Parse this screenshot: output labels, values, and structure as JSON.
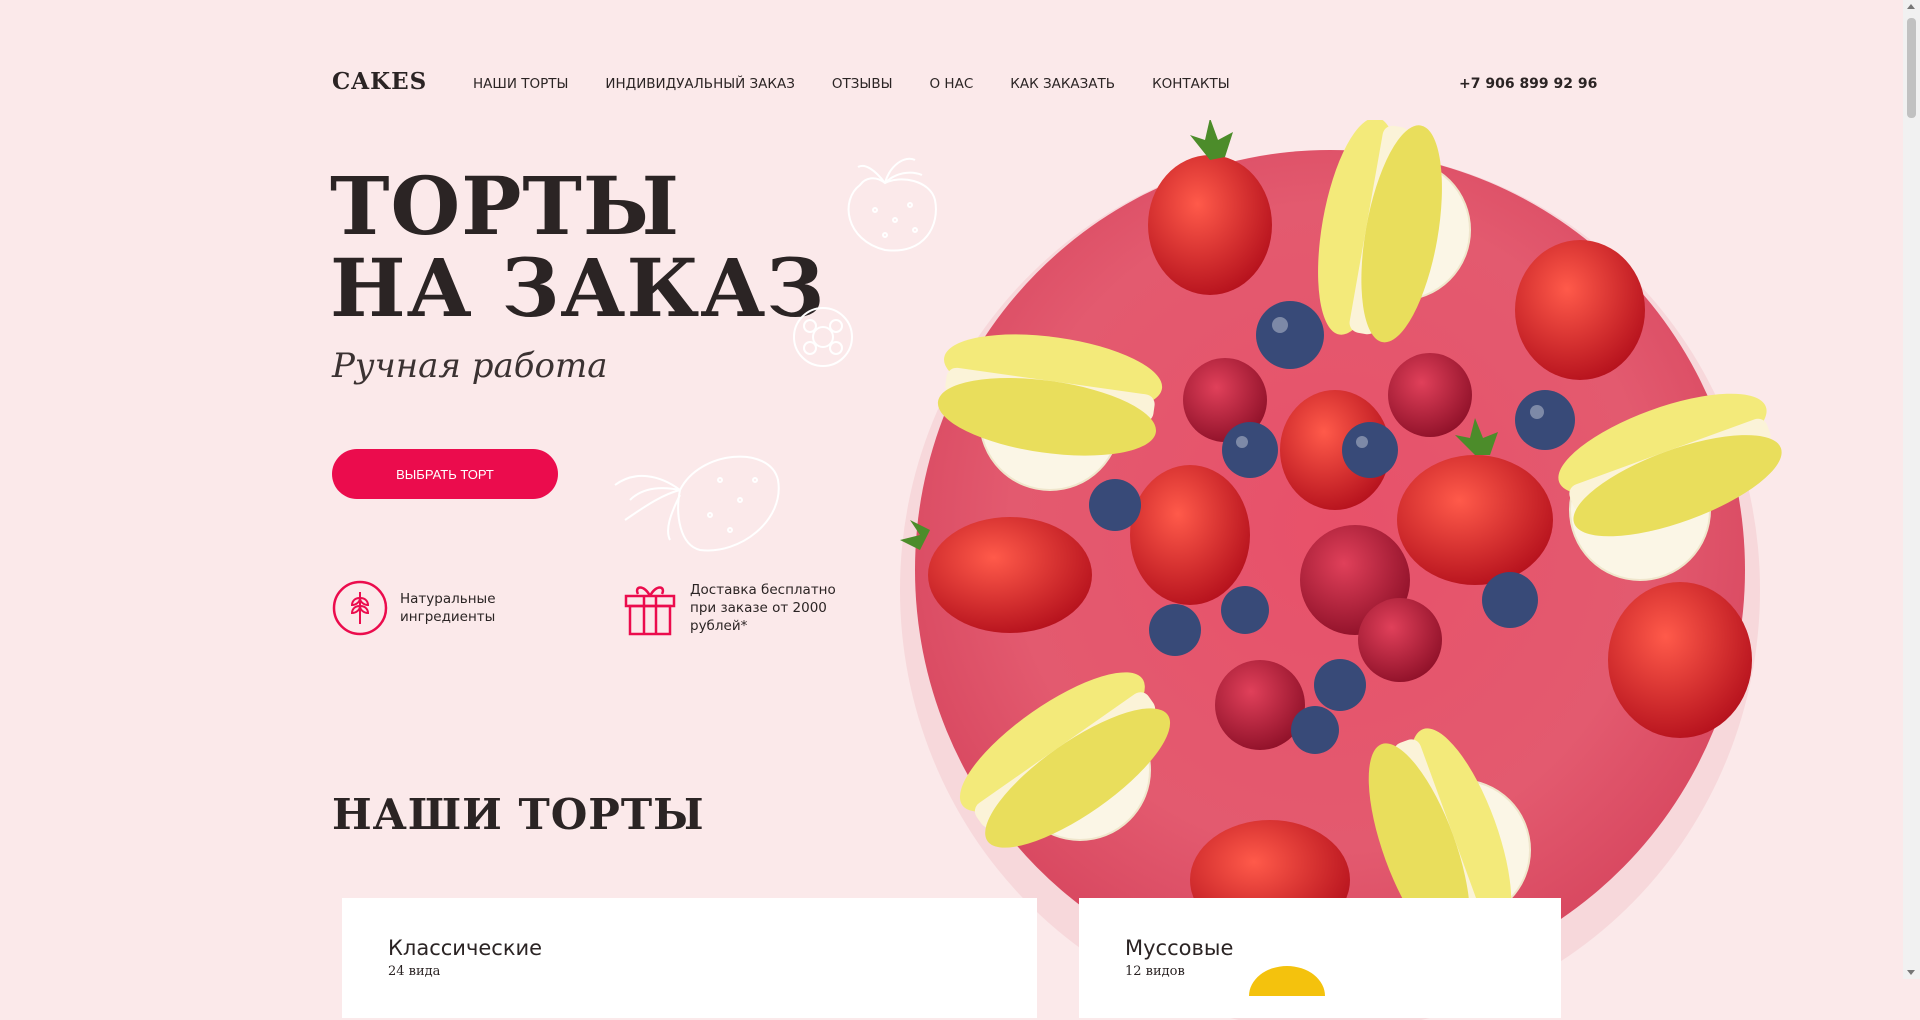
{
  "header": {
    "logo": "CAKES",
    "nav": [
      "НАШИ ТОРТЫ",
      "ИНДИВИДУАЛЬНЫЙ ЗАКАЗ",
      "ОТЗЫВЫ",
      "О НАС",
      "КАК ЗАКАЗАТЬ",
      "КОНТАКТЫ"
    ],
    "phone": "+7 906 899 92 96"
  },
  "hero": {
    "title_line1": "ТОРТЫ",
    "title_line2": "НА ЗАКАЗ",
    "subtitle": "Ручная работа",
    "cta": "ВЫБРАТЬ ТОРТ"
  },
  "features": [
    {
      "icon": "wheat-icon",
      "text": "Натуральные ингредиенты"
    },
    {
      "icon": "gift-icon",
      "text": "Доставка бесплатно при заказе от 2000 рублей*"
    }
  ],
  "section": {
    "title": "НАШИ ТОРТЫ",
    "cards": [
      {
        "name": "Классические",
        "count": "24 вида"
      },
      {
        "name": "Муссовые",
        "count": "12 видов"
      }
    ]
  },
  "colors": {
    "background": "#fbe9ea",
    "accent": "#eb0c4d",
    "text": "#2b2424"
  }
}
